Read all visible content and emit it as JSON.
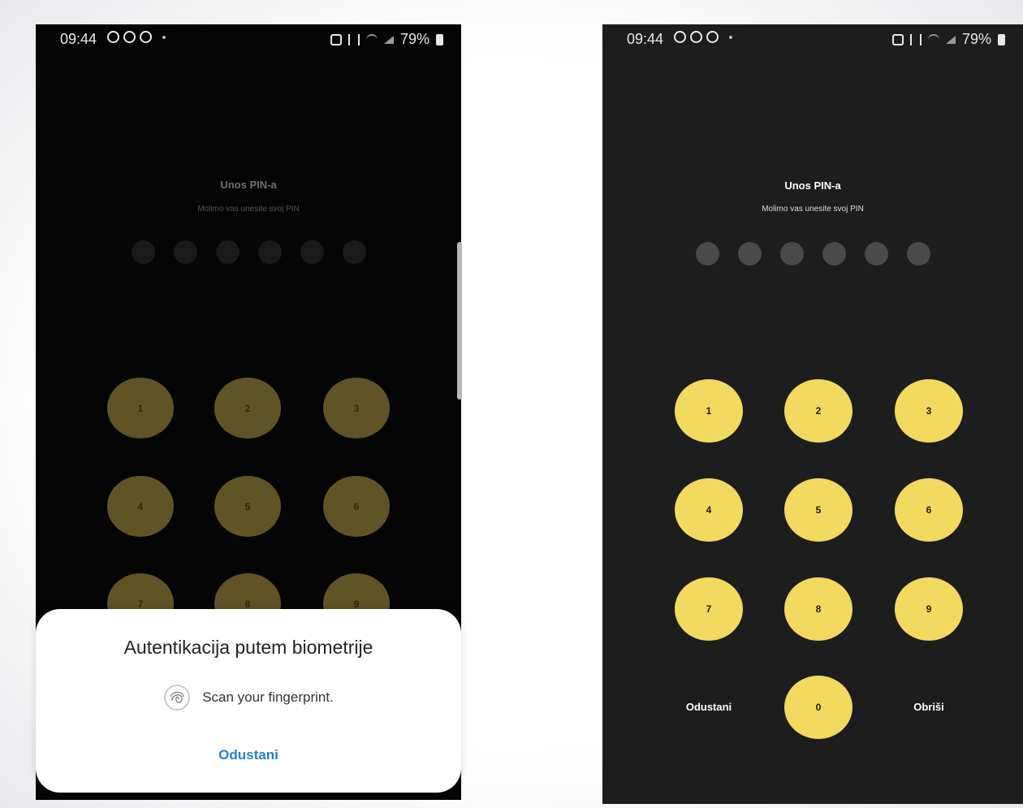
{
  "status_bar": {
    "time": "09:44",
    "battery": "79%"
  },
  "pin_screen": {
    "title": "Unos PIN-a",
    "subtitle": "Molimo vas unesite svoj PIN",
    "pin_length": 6,
    "keys": [
      "1",
      "2",
      "3",
      "4",
      "5",
      "6",
      "7",
      "8",
      "9",
      "0"
    ],
    "cancel_label": "Odustani",
    "delete_label": "Obriši"
  },
  "biometric_sheet": {
    "title": "Autentikacija putem biometrije",
    "scan_text": "Scan your fingerprint.",
    "cancel_label": "Odustani"
  },
  "colors": {
    "key_active": "#f2d95f",
    "key_dimmed": "#605426",
    "screen_bg_left": "#050505",
    "screen_bg_right": "#1d1d1d",
    "link_blue": "#2a7fc8"
  }
}
